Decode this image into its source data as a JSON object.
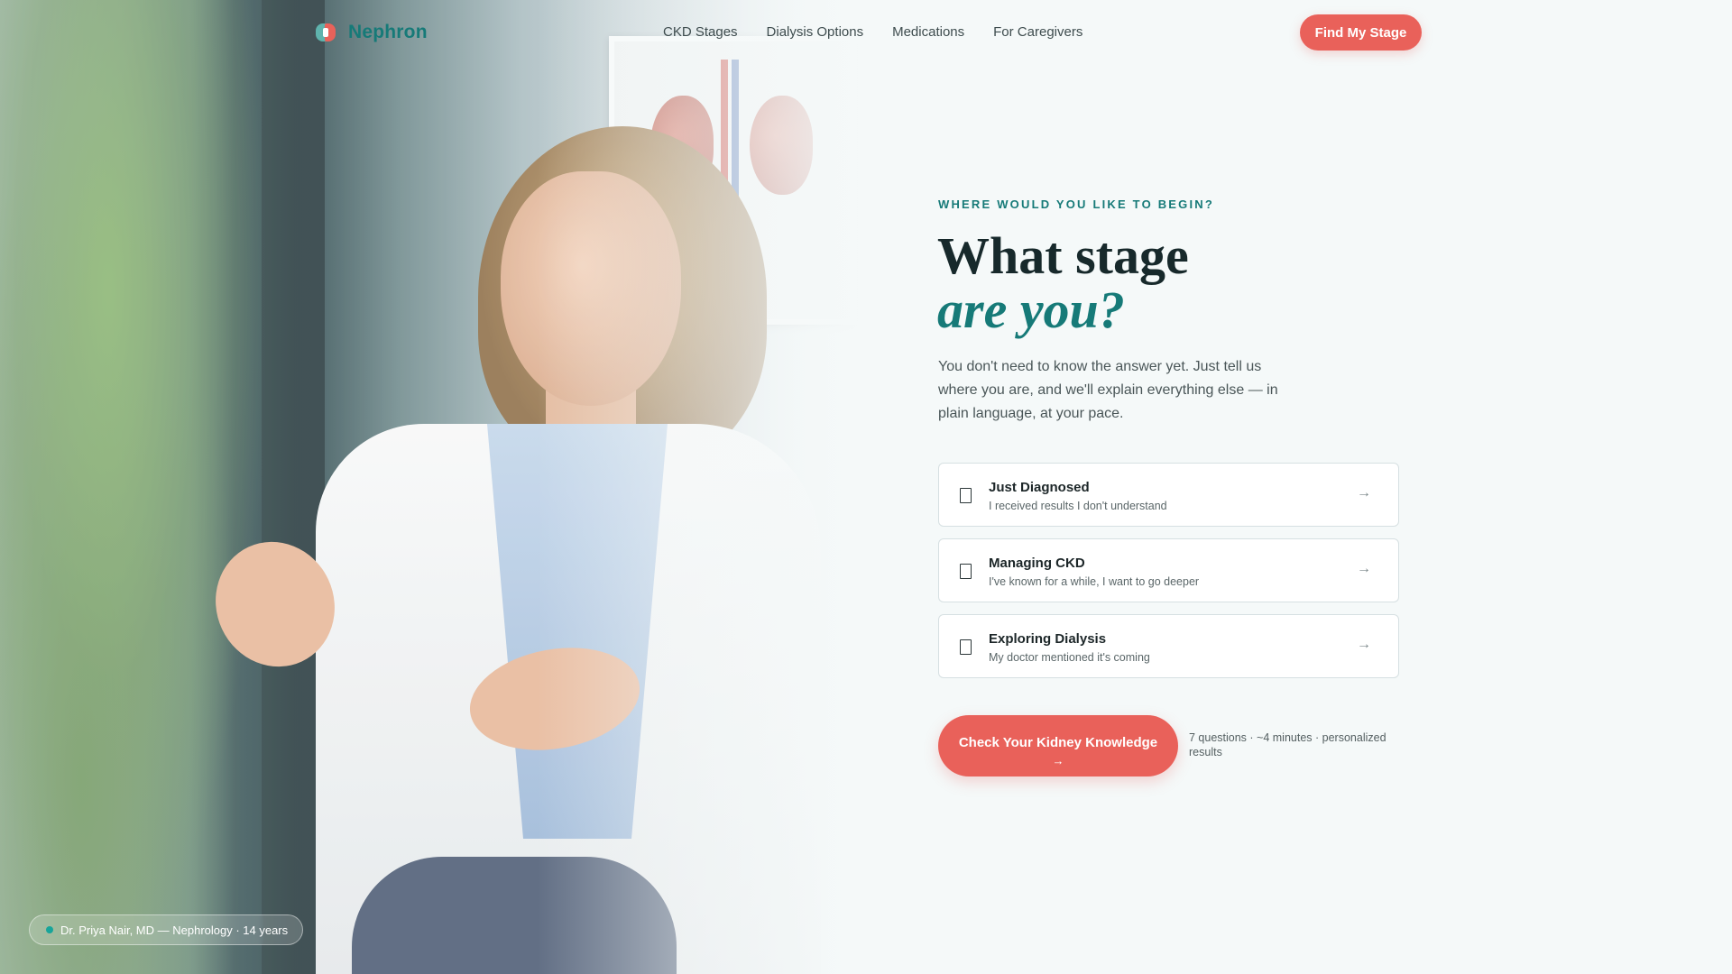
{
  "brand": {
    "name": "Nephron"
  },
  "nav": {
    "links": [
      "CKD Stages",
      "Dialysis Options",
      "Medications",
      "For Caregivers"
    ],
    "cta_label": "Find My Stage"
  },
  "hero": {
    "eyebrow": "WHERE WOULD YOU LIKE TO BEGIN?",
    "headline_line1": "What stage",
    "headline_line2": "are you?",
    "lede": "You don't need to know the answer yet. Just tell us where you are, and we'll explain everything else — in plain language, at your pace."
  },
  "options": [
    {
      "title": "Just Diagnosed",
      "subtitle": "I received results I don't understand",
      "arrow": "→"
    },
    {
      "title": "Managing CKD",
      "subtitle": "I've known for a while, I want to go deeper",
      "arrow": "→"
    },
    {
      "title": "Exploring Dialysis",
      "subtitle": "My doctor mentioned it's coming",
      "arrow": "→"
    }
  ],
  "quiz": {
    "button_label": "Check Your Kidney Knowledge",
    "button_arrow": "→",
    "meta": "7 questions · ~4 minutes · personalized results"
  },
  "photo_caption": "Dr. Priya Nair, MD — Nephrology · 14 years",
  "colors": {
    "accent": "#167a78",
    "cta": "#e9615a",
    "background": "#f5f9f9"
  }
}
